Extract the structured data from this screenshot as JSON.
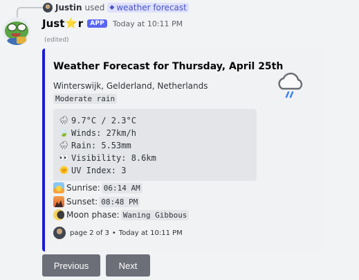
{
  "reply": {
    "username": "Justin",
    "used_text": "used",
    "command_name": "weather forecast"
  },
  "message": {
    "bot_name_prefix": "Just",
    "bot_name_emoji": "⭐",
    "bot_name_suffix": "r",
    "app_badge": "APP",
    "timestamp": "Today at 10:11 PM",
    "edited_label": "(edited)"
  },
  "embed": {
    "accent_color": "#1a1ad8",
    "title": "Weather Forecast for Thursday, April 25th",
    "location": "Winterswijk, Gelderland, Netherlands",
    "condition": "Moderate rain",
    "thumbnail_icon": "rain-cloud-icon",
    "stats": [
      {
        "icon": "rain-cloud-icon",
        "emoji": "🌧",
        "text": "9.7°C / 2.3°C"
      },
      {
        "icon": "leaf-wind-icon",
        "emoji": "🍃",
        "text": "Winds: 27km/h"
      },
      {
        "icon": "rain-cloud-icon",
        "emoji": "🌧",
        "text": "Rain: 5.53mm"
      },
      {
        "icon": "eyes-icon",
        "emoji": "👀",
        "text": "Visibility: 8.6km"
      },
      {
        "icon": "sun-icon",
        "emoji": "🌞",
        "text": "UV Index: 3"
      }
    ],
    "sunrise": {
      "label": "Sunrise:",
      "value": "06:14 AM"
    },
    "sunset": {
      "label": "Sunset:",
      "value": "08:48 PM"
    },
    "moon": {
      "label": "Moon phase:",
      "value": "Waning Gibbous"
    },
    "footer": {
      "page_text": "page 2 of 3",
      "separator": "•",
      "timestamp": "Today at 10:11 PM"
    }
  },
  "buttons": {
    "previous": "Previous",
    "next": "Next"
  },
  "colors": {
    "background": "#f2f3f5",
    "embed_background": "#f1f2f3",
    "button": "#6d6f78",
    "app_badge": "#5865f2"
  }
}
